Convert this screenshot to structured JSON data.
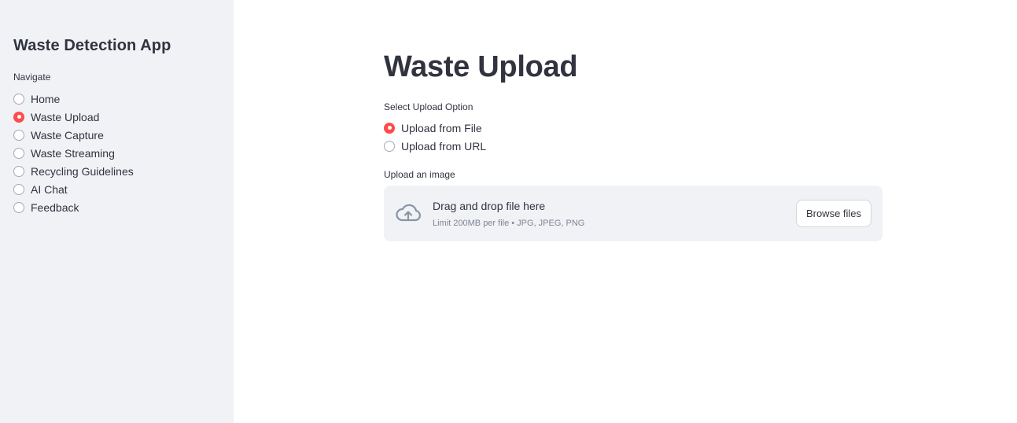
{
  "sidebar": {
    "title": "Waste Detection App",
    "nav_label": "Navigate",
    "items": [
      {
        "label": "Home",
        "selected": false
      },
      {
        "label": "Waste Upload",
        "selected": true
      },
      {
        "label": "Waste Capture",
        "selected": false
      },
      {
        "label": "Waste Streaming",
        "selected": false
      },
      {
        "label": "Recycling Guidelines",
        "selected": false
      },
      {
        "label": "AI Chat",
        "selected": false
      },
      {
        "label": "Feedback",
        "selected": false
      }
    ]
  },
  "main": {
    "title": "Waste Upload",
    "upload_option": {
      "label": "Select Upload Option",
      "options": [
        {
          "label": "Upload from File",
          "selected": true
        },
        {
          "label": "Upload from URL",
          "selected": false
        }
      ]
    },
    "uploader": {
      "label": "Upload an image",
      "drop_text": "Drag and drop file here",
      "limit_text": "Limit 200MB per file • JPG, JPEG, PNG",
      "browse_label": "Browse files",
      "icon": "cloud-upload-icon"
    }
  },
  "colors": {
    "accent": "#ff4b4b",
    "sidebar_bg": "#f0f2f6",
    "text": "#31333f"
  }
}
